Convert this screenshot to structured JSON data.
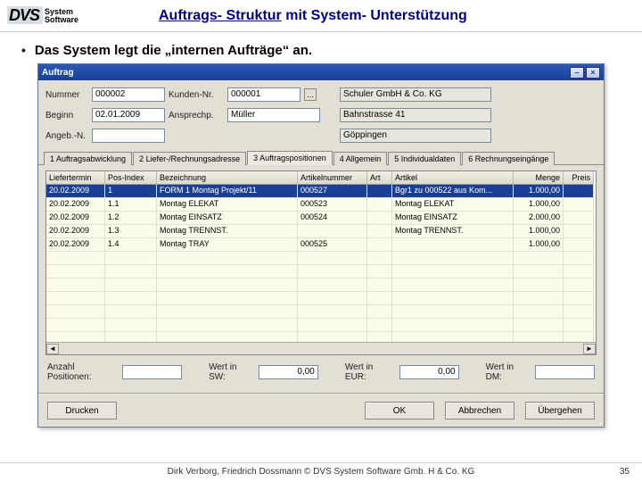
{
  "slide": {
    "title_part1": "Auftrags- Struktur",
    "title_part2": " mit System- Unterstützung",
    "bullet": "Das System legt die „internen Aufträge“ an.",
    "footer": "Dirk Verborg, Friedrich Dossmann © DVS System Software Gmb. H & Co. KG",
    "page": "35"
  },
  "logo": {
    "dvs": "DVS",
    "line1": "System",
    "line2": "Software"
  },
  "window": {
    "title": "Auftrag",
    "labels": {
      "nummer": "Nummer",
      "kundenr": "Kunden-Nr.",
      "beginn": "Beginn",
      "ansprechp": "Ansprechp.",
      "angebn": "Angeb.-N."
    },
    "fields": {
      "nummer": "000002",
      "kundenr": "000001",
      "kunde_name": "Schuler GmbH & Co. KG",
      "beginn": "02.01.2009",
      "ansprechp": "Müller",
      "strasse": "Bahnstrasse 41",
      "angebn": "",
      "ort": "Göppingen"
    },
    "tabs": [
      "1 Auftragsabwicklung",
      "2 Liefer-/Rechnungsadresse",
      "3 Auftragspositionen",
      "4 Allgemein",
      "5 Individualdaten",
      "6 Rechnungseingänge"
    ],
    "active_tab": 2,
    "columns": [
      "Liefertermin",
      "Pos-Index",
      "Bezeichnung",
      "Artikelnummer",
      "Art",
      "Artikel",
      "Menge",
      "Preis"
    ],
    "rows": [
      {
        "liefertermin": "20.02.2009",
        "pos": "1",
        "bez": "FORM 1 Montag Projekt/11",
        "artnr": "000527",
        "art": "",
        "artikel": "Bgr1 zu 000522 aus Kom...",
        "menge": "1.000,00",
        "preis": ""
      },
      {
        "liefertermin": "20.02.2009",
        "pos": "1.1",
        "bez": "Montag ELEKAT",
        "artnr": "000523",
        "art": "",
        "artikel": "Montag ELEKAT",
        "menge": "1.000,00",
        "preis": ""
      },
      {
        "liefertermin": "20.02.2009",
        "pos": "1.2",
        "bez": "Montag EINSATZ",
        "artnr": "000524",
        "art": "",
        "artikel": "Montag EINSATZ",
        "menge": "2.000,00",
        "preis": ""
      },
      {
        "liefertermin": "20.02.2009",
        "pos": "1.3",
        "bez": "Montag TRENNST.",
        "artnr": "",
        "art": "",
        "artikel": "Montag TRENNST.",
        "menge": "1.000,00",
        "preis": ""
      },
      {
        "liefertermin": "20.02.2009",
        "pos": "1.4",
        "bez": "Montag TRAY",
        "artnr": "000525",
        "art": "",
        "artikel": "",
        "menge": "1.000,00",
        "preis": ""
      }
    ],
    "summary": {
      "anzahl_label": "Anzahl Positionen:",
      "anzahl_value": "",
      "wert_sw_label": "Wert in SW:",
      "wert_sw_value": "0,00",
      "wert_eur_label": "Wert in EUR:",
      "wert_eur_value": "0,00",
      "wert_dm_label": "Wert in DM:",
      "wert_dm_value": ""
    },
    "buttons": {
      "drucken": "Drucken",
      "ok": "OK",
      "abbrechen": "Abbrechen",
      "uebergehen": "Übergehen"
    }
  }
}
